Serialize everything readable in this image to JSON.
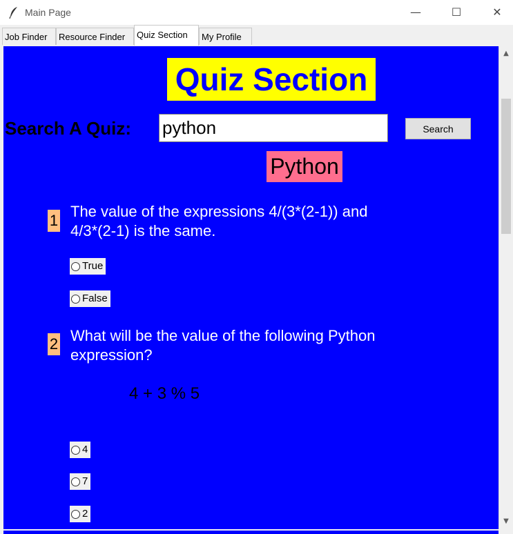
{
  "window": {
    "title": "Main Page",
    "minimize": "—",
    "maximize": "☐",
    "close": "✕"
  },
  "tabs": [
    {
      "label": "Job Finder",
      "active": false
    },
    {
      "label": "Resource Finder",
      "active": false
    },
    {
      "label": "Quiz Section",
      "active": true
    },
    {
      "label": "My Profile",
      "active": false
    }
  ],
  "quiz": {
    "title": "Quiz Section",
    "search_label": "Search A Quiz:",
    "search_value": "python",
    "search_button": "Search",
    "topic": "Python",
    "questions": [
      {
        "number": "1",
        "text": "The value of the expressions 4/(3*(2-1)) and\n4/3*(2-1) is the same.",
        "code": "",
        "options": [
          "True",
          "False"
        ]
      },
      {
        "number": "2",
        "text": " What will be the value of the following Python\nexpression?",
        "code": "4 + 3 % 5",
        "options": [
          "4",
          "7",
          "2"
        ]
      }
    ]
  },
  "scrollbar": {
    "up": "▲",
    "down": "▼"
  },
  "colors": {
    "canvas_bg": "#0000ff",
    "title_bg": "#ffff00",
    "title_fg": "#0000ff",
    "topic_bg": "#ff6e8e",
    "number_bg": "#ffbf80"
  }
}
